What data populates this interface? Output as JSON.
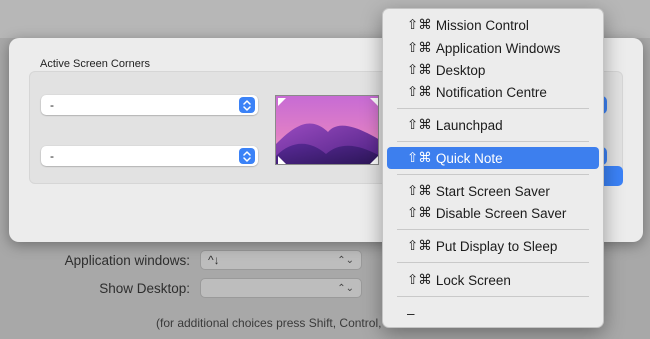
{
  "background": {
    "rows": [
      {
        "label": "Application windows:",
        "value": "^↓"
      },
      {
        "label": "Show Desktop:",
        "value": ""
      }
    ],
    "hint": "(for additional choices press Shift, Control,"
  },
  "sheet": {
    "title": "Active Screen Corners",
    "corners": {
      "top_left": "-",
      "bottom_left": "-"
    }
  },
  "menu": {
    "modifier_keys": "⇧⌘",
    "items": [
      {
        "label": "Mission Control"
      },
      {
        "label": "Application Windows"
      },
      {
        "label": "Desktop"
      },
      {
        "label": "Notification Centre"
      },
      {
        "label": "Launchpad"
      },
      {
        "label": "Quick Note",
        "selected": true
      },
      {
        "label": "Start Screen Saver"
      },
      {
        "label": "Disable Screen Saver"
      },
      {
        "label": "Put Display to Sleep"
      },
      {
        "label": "Lock Screen"
      },
      {
        "label": "–"
      }
    ]
  },
  "colors": {
    "accent": "#3b82f7",
    "selection": "#3d7fee"
  }
}
